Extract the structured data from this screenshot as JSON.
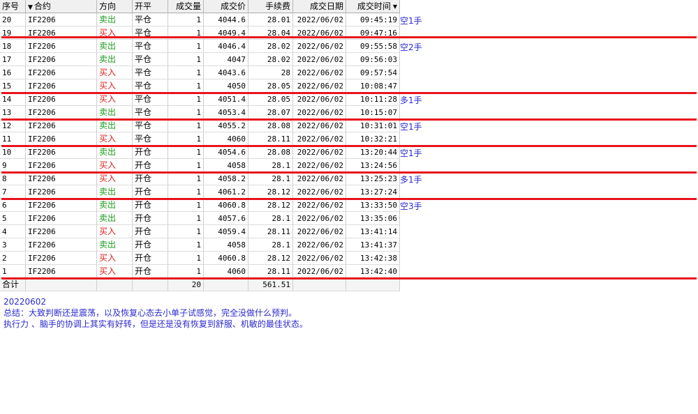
{
  "headers": {
    "seq": "序号",
    "contract": "合约",
    "direction": "方向",
    "openclose": "开平",
    "qty": "成交量",
    "price": "成交价",
    "fee": "手续费",
    "date": "成交日期",
    "time": "成交时间"
  },
  "rows": [
    {
      "seq": "20",
      "contract": "IF2206",
      "direction": "卖出",
      "side": "sell",
      "openclose": "平仓",
      "qty": "1",
      "price": "4044.6",
      "fee": "28.01",
      "date": "2022/06/02",
      "time": "09:45:19",
      "note": "空1手"
    },
    {
      "seq": "19",
      "contract": "IF2206",
      "direction": "买入",
      "side": "buy",
      "openclose": "平仓",
      "qty": "1",
      "price": "4049.4",
      "fee": "28.04",
      "date": "2022/06/02",
      "time": "09:47:16",
      "note": ""
    },
    {
      "seq": "18",
      "contract": "IF2206",
      "direction": "卖出",
      "side": "sell",
      "openclose": "平仓",
      "qty": "1",
      "price": "4046.4",
      "fee": "28.02",
      "date": "2022/06/02",
      "time": "09:55:58",
      "note": "空2手"
    },
    {
      "seq": "17",
      "contract": "IF2206",
      "direction": "卖出",
      "side": "sell",
      "openclose": "平仓",
      "qty": "1",
      "price": "4047",
      "fee": "28.02",
      "date": "2022/06/02",
      "time": "09:56:03",
      "note": ""
    },
    {
      "seq": "16",
      "contract": "IF2206",
      "direction": "买入",
      "side": "buy",
      "openclose": "平仓",
      "qty": "1",
      "price": "4043.6",
      "fee": "28",
      "date": "2022/06/02",
      "time": "09:57:54",
      "note": ""
    },
    {
      "seq": "15",
      "contract": "IF2206",
      "direction": "买入",
      "side": "buy",
      "openclose": "平仓",
      "qty": "1",
      "price": "4050",
      "fee": "28.05",
      "date": "2022/06/02",
      "time": "10:08:47",
      "note": ""
    },
    {
      "seq": "14",
      "contract": "IF2206",
      "direction": "买入",
      "side": "buy",
      "openclose": "平仓",
      "qty": "1",
      "price": "4051.4",
      "fee": "28.05",
      "date": "2022/06/02",
      "time": "10:11:28",
      "note": "多1手"
    },
    {
      "seq": "13",
      "contract": "IF2206",
      "direction": "卖出",
      "side": "sell",
      "openclose": "平仓",
      "qty": "1",
      "price": "4053.4",
      "fee": "28.07",
      "date": "2022/06/02",
      "time": "10:15:07",
      "note": ""
    },
    {
      "seq": "12",
      "contract": "IF2206",
      "direction": "卖出",
      "side": "sell",
      "openclose": "平仓",
      "qty": "1",
      "price": "4055.2",
      "fee": "28.08",
      "date": "2022/06/02",
      "time": "10:31:01",
      "note": "空1手"
    },
    {
      "seq": "11",
      "contract": "IF2206",
      "direction": "买入",
      "side": "buy",
      "openclose": "平仓",
      "qty": "1",
      "price": "4060",
      "fee": "28.11",
      "date": "2022/06/02",
      "time": "10:32:21",
      "note": ""
    },
    {
      "seq": "10",
      "contract": "IF2206",
      "direction": "卖出",
      "side": "sell",
      "openclose": "开仓",
      "qty": "1",
      "price": "4054.6",
      "fee": "28.08",
      "date": "2022/06/02",
      "time": "13:20:44",
      "note": "空1手"
    },
    {
      "seq": "9",
      "contract": "IF2206",
      "direction": "买入",
      "side": "buy",
      "openclose": "开仓",
      "qty": "1",
      "price": "4058",
      "fee": "28.1",
      "date": "2022/06/02",
      "time": "13:24:56",
      "note": ""
    },
    {
      "seq": "8",
      "contract": "IF2206",
      "direction": "买入",
      "side": "buy",
      "openclose": "开仓",
      "qty": "1",
      "price": "4058.2",
      "fee": "28.1",
      "date": "2022/06/02",
      "time": "13:25:23",
      "note": "多1手"
    },
    {
      "seq": "7",
      "contract": "IF2206",
      "direction": "卖出",
      "side": "sell",
      "openclose": "开仓",
      "qty": "1",
      "price": "4061.2",
      "fee": "28.12",
      "date": "2022/06/02",
      "time": "13:27:24",
      "note": ""
    },
    {
      "seq": "6",
      "contract": "IF2206",
      "direction": "卖出",
      "side": "sell",
      "openclose": "开仓",
      "qty": "1",
      "price": "4060.8",
      "fee": "28.12",
      "date": "2022/06/02",
      "time": "13:33:50",
      "note": "空3手"
    },
    {
      "seq": "5",
      "contract": "IF2206",
      "direction": "卖出",
      "side": "sell",
      "openclose": "开仓",
      "qty": "1",
      "price": "4057.6",
      "fee": "28.1",
      "date": "2022/06/02",
      "time": "13:35:06",
      "note": ""
    },
    {
      "seq": "4",
      "contract": "IF2206",
      "direction": "买入",
      "side": "buy",
      "openclose": "开仓",
      "qty": "1",
      "price": "4059.4",
      "fee": "28.11",
      "date": "2022/06/02",
      "time": "13:41:14",
      "note": ""
    },
    {
      "seq": "3",
      "contract": "IF2206",
      "direction": "卖出",
      "side": "sell",
      "openclose": "开仓",
      "qty": "1",
      "price": "4058",
      "fee": "28.1",
      "date": "2022/06/02",
      "time": "13:41:37",
      "note": ""
    },
    {
      "seq": "2",
      "contract": "IF2206",
      "direction": "买入",
      "side": "buy",
      "openclose": "开仓",
      "qty": "1",
      "price": "4060.8",
      "fee": "28.12",
      "date": "2022/06/02",
      "time": "13:42:38",
      "note": ""
    },
    {
      "seq": "1",
      "contract": "IF2206",
      "direction": "买入",
      "side": "buy",
      "openclose": "开仓",
      "qty": "1",
      "price": "4060",
      "fee": "28.11",
      "date": "2022/06/02",
      "time": "13:42:40",
      "note": ""
    }
  ],
  "totals": {
    "label": "合计",
    "qty": "20",
    "fee": "561.51"
  },
  "summary": {
    "date": "20220602",
    "line1": "总结：大致判断还是震荡，以及恢复心态去小单子试感觉，完全没做什么预判。",
    "line2": "执行力 、脑手的协调上其实有好转，但是还是没有恢复到舒服、机敏的最佳状态。"
  },
  "icons": {
    "filter": "funnel-icon",
    "sort": "sort-down-icon"
  },
  "colors": {
    "sell": "#1a9c1a",
    "buy": "#e02020",
    "annotation": "#2a2ad0",
    "divider": "#e8141c"
  }
}
